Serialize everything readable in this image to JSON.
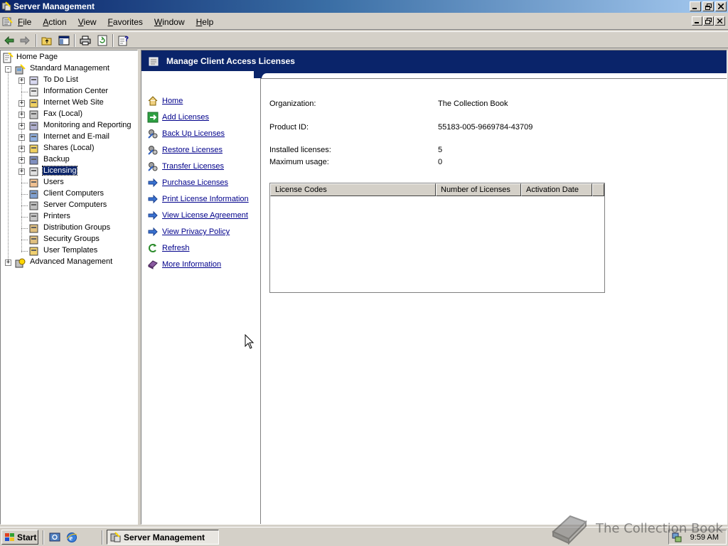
{
  "window": {
    "title": "Server Management"
  },
  "menu": {
    "items": [
      "File",
      "Action",
      "View",
      "Favorites",
      "Window",
      "Help"
    ]
  },
  "toolbar": {
    "buttons": [
      "back-icon",
      "forward-icon",
      "up-folder-icon",
      "show-hide-tree-icon",
      "print-icon",
      "refresh-icon",
      "help-icon"
    ]
  },
  "tree": {
    "home": "Home Page",
    "standard": "Standard Management",
    "children": [
      "To Do List",
      "Information Center",
      "Internet Web Site",
      "Fax (Local)",
      "Monitoring and Reporting",
      "Internet and E-mail",
      "Shares (Local)",
      "Backup",
      "Licensing",
      "Users",
      "Client Computers",
      "Server Computers",
      "Printers",
      "Distribution Groups",
      "Security Groups",
      "User Templates"
    ],
    "advanced": "Advanced Management",
    "selected": "Licensing"
  },
  "taskpad": {
    "title": "Manage Client Access Licenses",
    "links": [
      "Home",
      "Add Licenses",
      "Back Up Licenses",
      "Restore Licenses",
      "Transfer Licenses",
      "Purchase Licenses",
      "Print License Information",
      "View License Agreement",
      "View Privacy Policy",
      "Refresh",
      "More Information"
    ]
  },
  "info": {
    "organization_label": "Organization:",
    "organization_value": "The Collection Book",
    "product_id_label": "Product ID:",
    "product_id_value": "55183-005-9669784-43709",
    "installed_label": "Installed licenses:",
    "installed_value": "5",
    "max_usage_label": "Maximum usage:",
    "max_usage_value": "0"
  },
  "license_table": {
    "columns": [
      "License Codes",
      "Number of Licenses",
      "Activation Date"
    ],
    "rows": []
  },
  "taskbar": {
    "start": "Start",
    "task": "Server Management",
    "clock": "9:59 AM"
  },
  "watermark": {
    "text": "The Collection Book"
  },
  "colors": {
    "title_bar": "#0a246a",
    "taskpad_header": "#0a246a",
    "link": "#00008b",
    "face": "#d4d0c8"
  }
}
